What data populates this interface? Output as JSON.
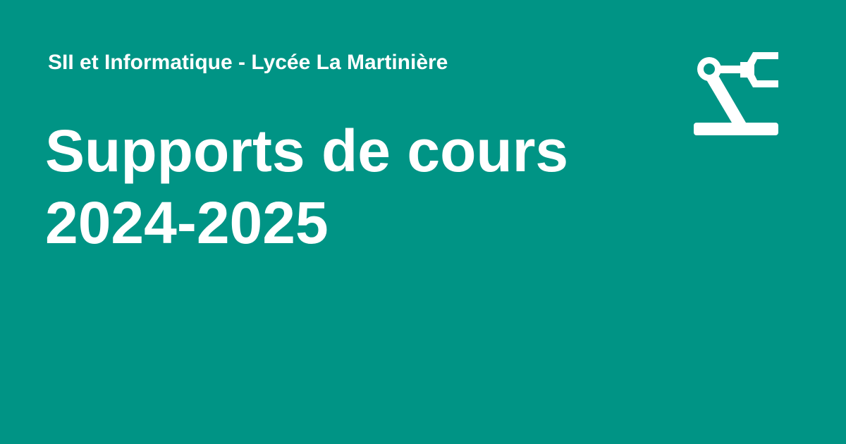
{
  "site": {
    "name": "SII et Informatique - Lycée La Martinière"
  },
  "page": {
    "title_line1": "Supports de cours",
    "title_line2": "2024-2025"
  },
  "logo": {
    "icon": "robot-arm-icon"
  },
  "colors": {
    "background": "#009485",
    "foreground": "#ffffff"
  }
}
